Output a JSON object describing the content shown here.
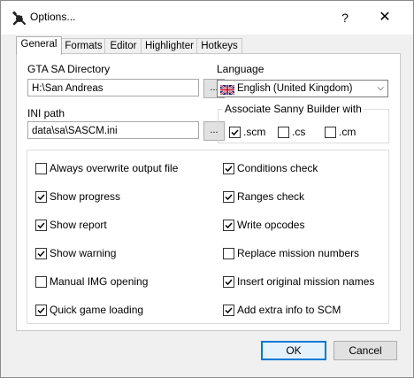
{
  "window": {
    "title": "Options...",
    "help_label": "?",
    "close_label": "✕"
  },
  "tabs": [
    {
      "label": "General",
      "active": true
    },
    {
      "label": "Formats"
    },
    {
      "label": "Editor"
    },
    {
      "label": "Highlighter"
    },
    {
      "label": "Hotkeys"
    }
  ],
  "general": {
    "gta_dir": {
      "label": "GTA SA Directory",
      "value": "H:\\San Andreas",
      "browse_label": "..."
    },
    "ini_path": {
      "label": "INI path",
      "value": "data\\sa\\SASCM.ini",
      "browse_label": "..."
    },
    "language": {
      "label": "Language",
      "selected": "English (United Kingdom)",
      "flag": "uk-flag-icon"
    },
    "associate": {
      "title": "Associate Sanny Builder with",
      "options": [
        {
          "label": ".scm",
          "checked": true
        },
        {
          "label": ".cs",
          "checked": false
        },
        {
          "label": ".cm",
          "checked": false
        }
      ]
    },
    "options_left": [
      {
        "label": "Always overwrite output file",
        "checked": false
      },
      {
        "label": "Show progress",
        "checked": true
      },
      {
        "label": "Show report",
        "checked": true
      },
      {
        "label": "Show warning",
        "checked": true
      },
      {
        "label": "Manual IMG opening",
        "checked": false
      },
      {
        "label": "Quick game loading",
        "checked": true
      }
    ],
    "options_right": [
      {
        "label": "Conditions check",
        "checked": true
      },
      {
        "label": "Ranges check",
        "checked": true
      },
      {
        "label": "Write opcodes",
        "checked": true
      },
      {
        "label": "Replace mission numbers",
        "checked": false
      },
      {
        "label": "Insert original mission names",
        "checked": true
      },
      {
        "label": "Add extra info to SCM",
        "checked": true
      }
    ]
  },
  "buttons": {
    "ok_label": "OK",
    "cancel_label": "Cancel"
  },
  "colors": {
    "accent": "#0078d7",
    "panel_bg": "#ffffff",
    "window_bg": "#f0f0f0"
  }
}
